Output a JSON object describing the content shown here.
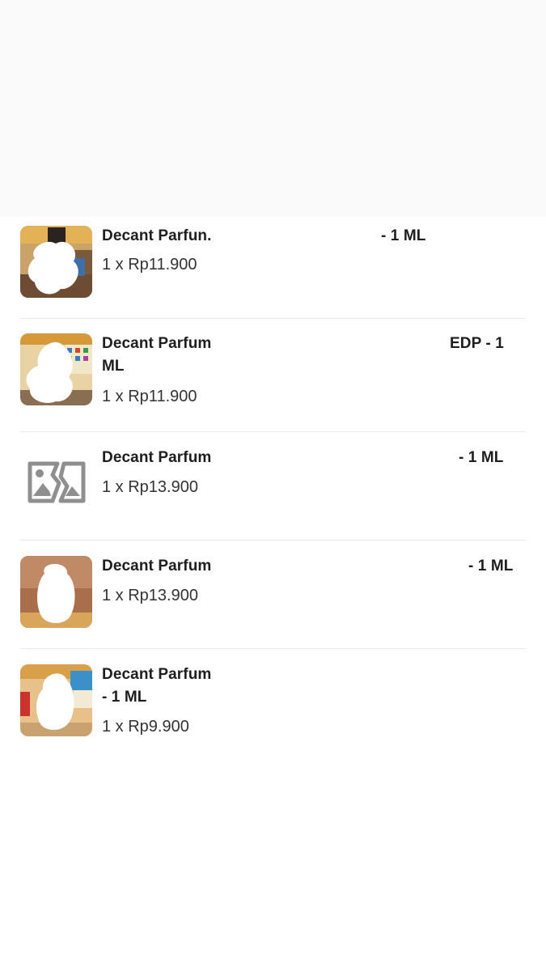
{
  "orders": [
    {
      "title_start": "Decant Parfun.",
      "title_end": "- 1 ML",
      "quantity_price": "1 x Rp11.900",
      "thumbnail": "product-photo"
    },
    {
      "title_start": "Decant Parfum",
      "title_end": "EDP - 1",
      "title_line2": "ML",
      "quantity_price": "1 x Rp11.900",
      "thumbnail": "product-photo"
    },
    {
      "title_start": "Decant Parfum",
      "title_end": "- 1 ML",
      "quantity_price": "1 x Rp13.900",
      "thumbnail": "broken-image-icon"
    },
    {
      "title_start": "Decant Parfum",
      "title_end": "- 1 ML",
      "quantity_price": "1 x Rp13.900",
      "thumbnail": "product-photo"
    },
    {
      "title_start": "Decant Parfum",
      "title_line2": "- 1 ML",
      "quantity_price": "1 x Rp9.900",
      "thumbnail": "product-photo"
    }
  ],
  "colors": {
    "text_primary": "#1e1e1e",
    "text_secondary": "#333333",
    "divider": "#e9e9e9",
    "broken_icon": "#8f8f8f"
  }
}
